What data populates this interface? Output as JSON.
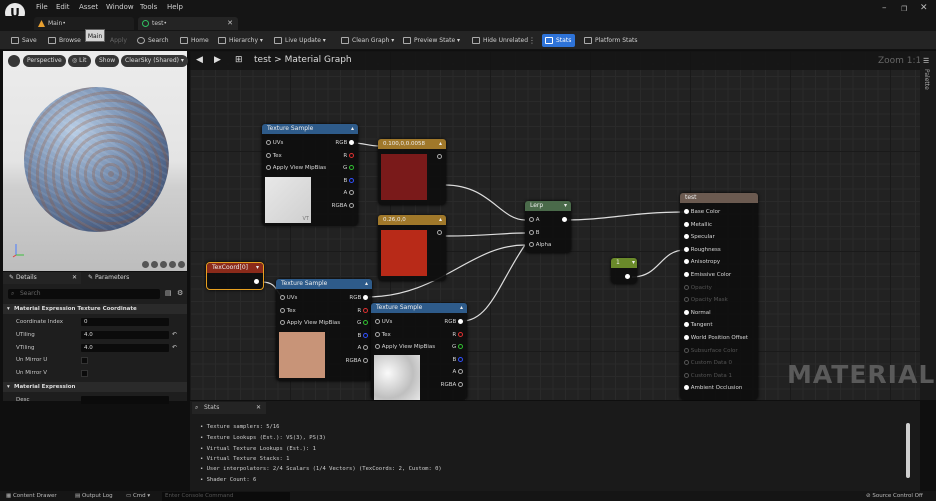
{
  "menu": [
    "File",
    "Edit",
    "Asset",
    "Window",
    "Tools",
    "Help"
  ],
  "tabs": [
    {
      "label": "Main•",
      "icon": "level-icon",
      "color": "#e8a030"
    },
    {
      "label": "test•",
      "icon": "material-icon",
      "color": "#30c060"
    }
  ],
  "tooltip": "Main",
  "toolbar": {
    "save": "Save",
    "browse": "Browse",
    "apply": "Apply",
    "search": "Search",
    "home": "Home",
    "hierarchy": "Hierarchy ▾",
    "live_update": "Live Update ▾",
    "clean_graph": "Clean Graph ▾",
    "preview_state": "Preview State ▾",
    "hide_unrelated": "Hide Unrelated",
    "stats": "Stats",
    "platform_stats": "Platform Stats"
  },
  "viewport": {
    "perspective": "Perspective",
    "lit": "Lit",
    "show": "Show",
    "sky": "ClearSky (Shared) ▾"
  },
  "details": {
    "tab_details": "Details",
    "tab_parameters": "Parameters",
    "search_placeholder": "Search",
    "section1": "Material Expression Texture Coordinate",
    "props": [
      {
        "label": "Coordinate Index",
        "value": "0"
      },
      {
        "label": "UTiling",
        "value": "4.0"
      },
      {
        "label": "VTiling",
        "value": "4.0"
      }
    ],
    "checks": [
      {
        "label": "Un Mirror U"
      },
      {
        "label": "Un Mirror V"
      }
    ],
    "section2": "Material Expression",
    "desc_label": "Desc"
  },
  "graph": {
    "crumb_root": "test",
    "crumb_sep": ">",
    "crumb_page": "Material Graph",
    "zoom": "Zoom 1:1",
    "watermark": "MATERIAL",
    "palette": "Palette"
  },
  "nodes": {
    "tex1": {
      "title": "Texture Sample",
      "uvs": "UVs",
      "tex": "Tex",
      "mip": "Apply View MipBias",
      "rgb": "RGB",
      "r": "R",
      "g": "G",
      "b": "B",
      "a": "A",
      "rgba": "RGBA",
      "vt": "VT"
    },
    "const1": {
      "title": "0.100,0,0.0058",
      "color": "#7a1a1a"
    },
    "const2": {
      "title": "0.26,0,0",
      "color": "#b82a18"
    },
    "texcoord": {
      "title": "TexCoord[0]"
    },
    "tex2": {
      "title": "Texture Sample",
      "uvs": "UVs",
      "tex": "Tex",
      "mip": "Apply View MipBias",
      "rgb": "RGB",
      "r": "R",
      "g": "G",
      "b": "B",
      "a": "A",
      "rgba": "RGBA"
    },
    "tex3": {
      "title": "Texture Sample",
      "uvs": "UVs",
      "tex": "Tex",
      "mip": "Apply View MipBias",
      "rgb": "RGB",
      "r": "R",
      "g": "G",
      "b": "B",
      "a": "A",
      "rgba": "RGBA"
    },
    "lerp": {
      "title": "Lerp",
      "a": "A",
      "b": "B",
      "alpha": "Alpha"
    },
    "scalar": {
      "title": "1"
    },
    "result": {
      "title": "test",
      "pins": [
        {
          "label": "Base Color",
          "on": true
        },
        {
          "label": "Metallic",
          "on": true
        },
        {
          "label": "Specular",
          "on": true
        },
        {
          "label": "Roughness",
          "on": true
        },
        {
          "label": "Anisotropy",
          "on": true
        },
        {
          "label": "Emissive Color",
          "on": true
        },
        {
          "label": "Opacity",
          "on": false
        },
        {
          "label": "Opacity Mask",
          "on": false
        },
        {
          "label": "Normal",
          "on": true
        },
        {
          "label": "Tangent",
          "on": true
        },
        {
          "label": "World Position Offset",
          "on": true
        },
        {
          "label": "Subsurface Color",
          "on": false
        },
        {
          "label": "Custom Data 0",
          "on": false
        },
        {
          "label": "Custom Data 1",
          "on": false
        },
        {
          "label": "Ambient Occlusion",
          "on": true
        }
      ]
    }
  },
  "stats": {
    "tab": "Stats",
    "lines": [
      "Texture samplers: 5/16",
      "Texture Lookups (Est.): VS(3), PS(3)",
      "Virtual Texture Lookups (Est.): 1",
      "Virtual Texture Stacks: 1",
      "User interpolators: 2/4 Scalars (1/4 Vectors) (TexCoords: 2, Custom: 0)",
      "Shader Count: 6"
    ]
  },
  "bottom": {
    "content_drawer": "Content Drawer",
    "output_log": "Output Log",
    "cmd": "Cmd ▾",
    "cmd_placeholder": "Enter Console Command",
    "source_control": "Source Control Off"
  }
}
